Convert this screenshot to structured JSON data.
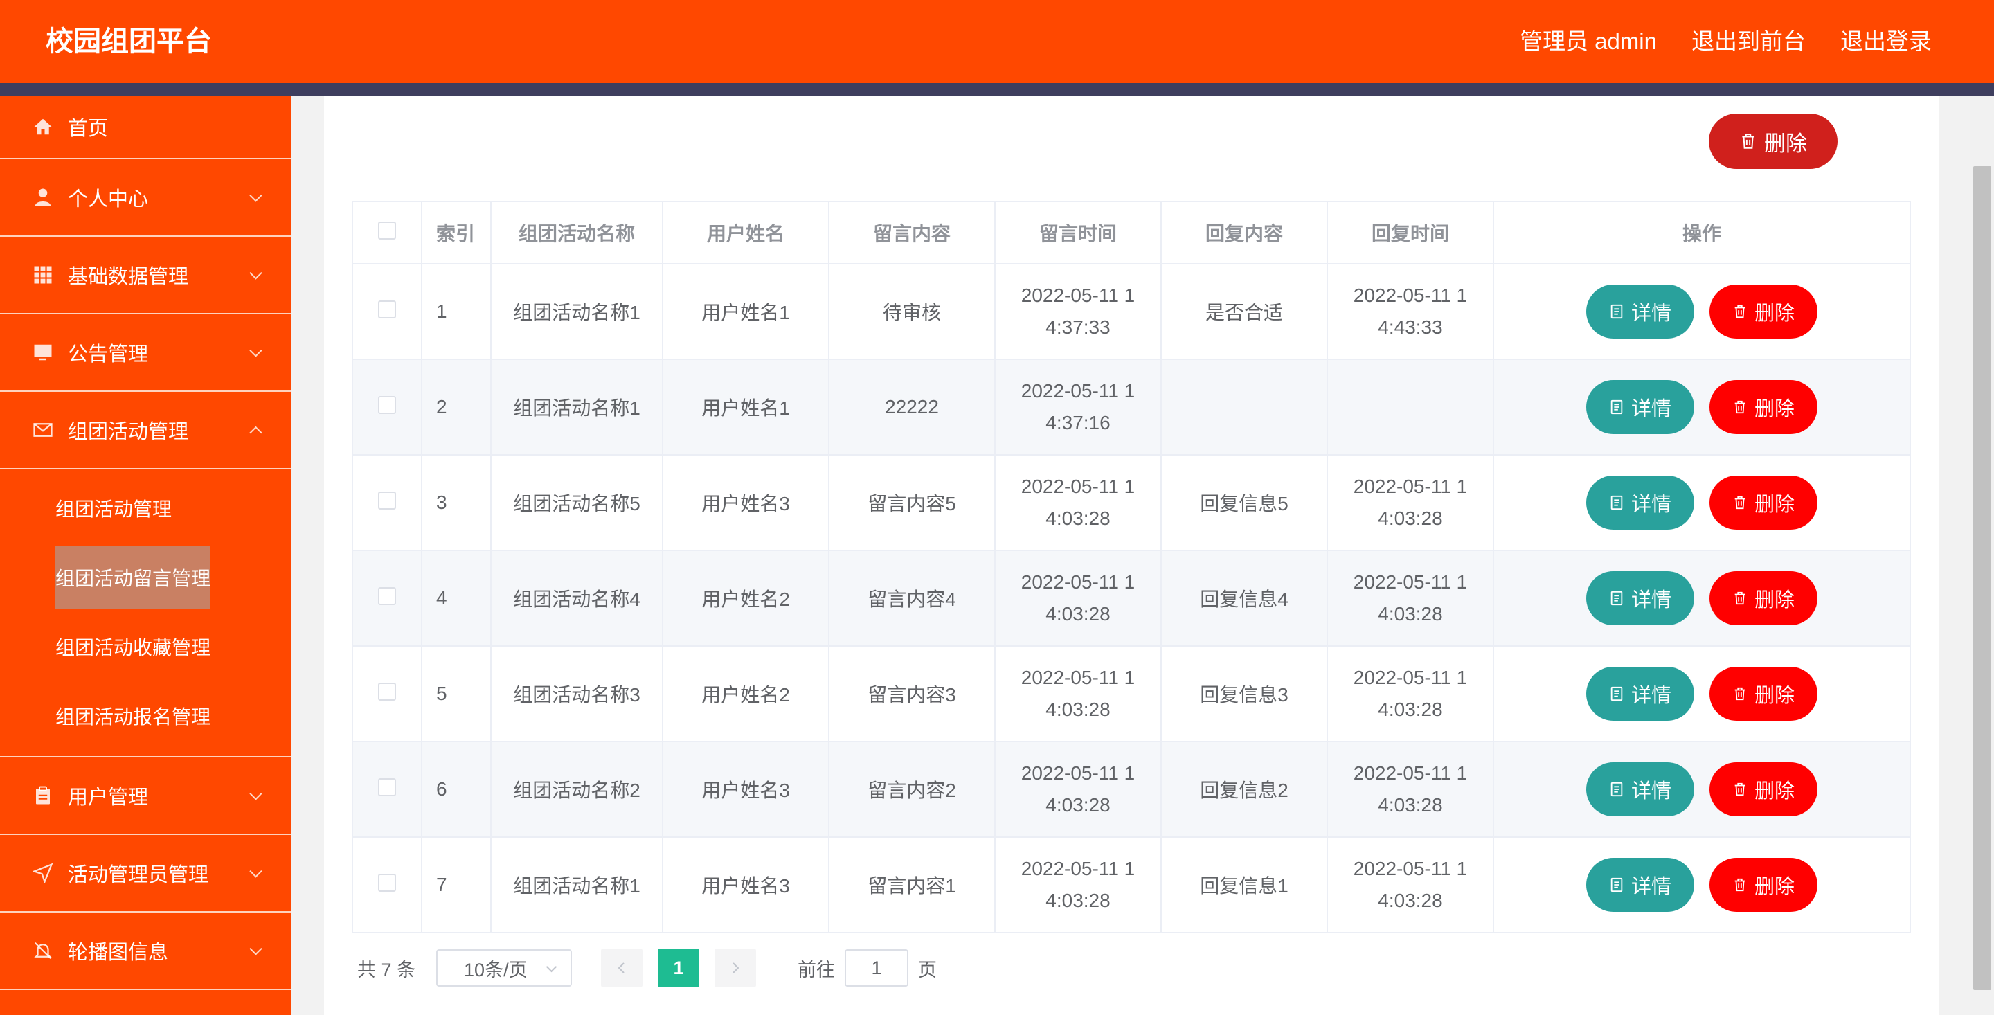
{
  "header": {
    "brand": "校园组团平台",
    "user_label": "管理员 admin",
    "front_link": "退出到前台",
    "logout_link": "退出登录"
  },
  "sidebar": {
    "items": [
      {
        "label": "首页",
        "icon": "home-icon"
      },
      {
        "label": "个人中心",
        "icon": "user-icon"
      },
      {
        "label": "基础数据管理",
        "icon": "grid-icon"
      },
      {
        "label": "公告管理",
        "icon": "monitor-icon"
      },
      {
        "label": "组团活动管理",
        "icon": "mail-icon"
      },
      {
        "label": "用户管理",
        "icon": "clipboard-icon"
      },
      {
        "label": "活动管理员管理",
        "icon": "send-icon"
      },
      {
        "label": "轮播图信息",
        "icon": "bell-off-icon"
      }
    ],
    "submenu": [
      {
        "label": "组团活动管理"
      },
      {
        "label": "组团活动留言管理"
      },
      {
        "label": "组团活动收藏管理"
      },
      {
        "label": "组团活动报名管理"
      }
    ]
  },
  "toolbar": {
    "delete_label": "删除"
  },
  "table": {
    "columns": [
      "索引",
      "组团活动名称",
      "用户姓名",
      "留言内容",
      "留言时间",
      "回复内容",
      "回复时间",
      "操作"
    ],
    "detail_label": "详情",
    "delete_label": "删除",
    "rows": [
      {
        "idx": "1",
        "activity": "组团活动名称1",
        "user": "用户姓名1",
        "content": "待审核",
        "time": "2022-05-11 14:37:33",
        "reply": "是否合适",
        "reply_time": "2022-05-11 14:43:33"
      },
      {
        "idx": "2",
        "activity": "组团活动名称1",
        "user": "用户姓名1",
        "content": "22222",
        "time": "2022-05-11 14:37:16",
        "reply": "",
        "reply_time": ""
      },
      {
        "idx": "3",
        "activity": "组团活动名称5",
        "user": "用户姓名3",
        "content": "留言内容5",
        "time": "2022-05-11 14:03:28",
        "reply": "回复信息5",
        "reply_time": "2022-05-11 14:03:28"
      },
      {
        "idx": "4",
        "activity": "组团活动名称4",
        "user": "用户姓名2",
        "content": "留言内容4",
        "time": "2022-05-11 14:03:28",
        "reply": "回复信息4",
        "reply_time": "2022-05-11 14:03:28"
      },
      {
        "idx": "5",
        "activity": "组团活动名称3",
        "user": "用户姓名2",
        "content": "留言内容3",
        "time": "2022-05-11 14:03:28",
        "reply": "回复信息3",
        "reply_time": "2022-05-11 14:03:28"
      },
      {
        "idx": "6",
        "activity": "组团活动名称2",
        "user": "用户姓名3",
        "content": "留言内容2",
        "time": "2022-05-11 14:03:28",
        "reply": "回复信息2",
        "reply_time": "2022-05-11 14:03:28"
      },
      {
        "idx": "7",
        "activity": "组团活动名称1",
        "user": "用户姓名3",
        "content": "留言内容1",
        "time": "2022-05-11 14:03:28",
        "reply": "回复信息1",
        "reply_time": "2022-05-11 14:03:28"
      }
    ]
  },
  "pagination": {
    "total": "共 7 条",
    "page_size": "10条/页",
    "current_page": "1",
    "goto_label": "前往",
    "goto_value": "1",
    "page_unit": "页"
  },
  "colors": {
    "brand": "#ff4800",
    "detail_button": "#29a19c",
    "delete_button": "#ff0000",
    "active_page": "#1ebc92"
  }
}
